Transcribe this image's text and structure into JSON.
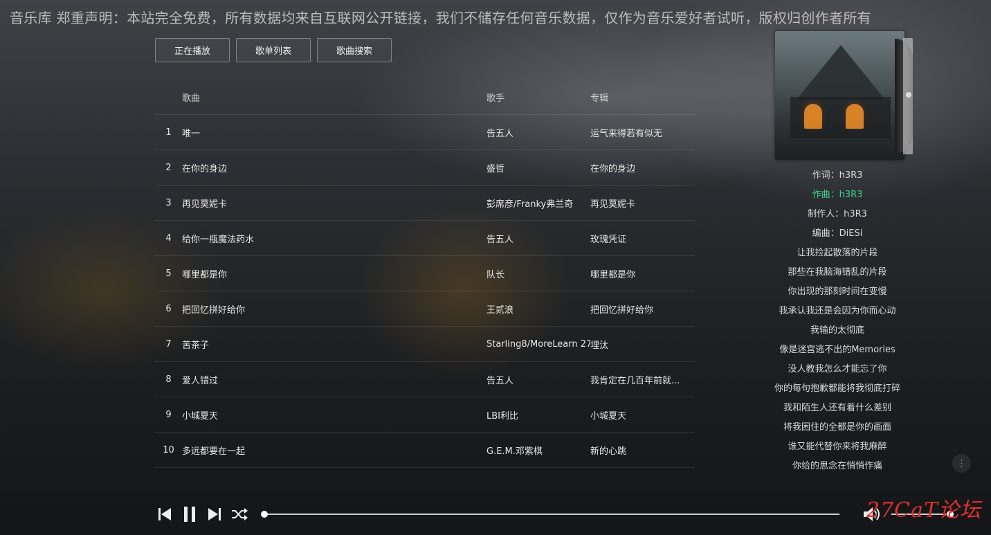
{
  "banner": "音乐库 郑重声明：本站完全免费，所有数据均来自互联网公开链接，我们不储存任何音乐数据，仅作为音乐爱好者试听，版权归创作者所有",
  "tabs": [
    {
      "label": "正在播放"
    },
    {
      "label": "歌单列表"
    },
    {
      "label": "歌曲搜索"
    }
  ],
  "table": {
    "headers": {
      "song": "歌曲",
      "artist": "歌手",
      "album": "专辑"
    },
    "rows": [
      {
        "num": "1",
        "song": "唯一",
        "artist": "告五人",
        "album": "运气来得若有似无"
      },
      {
        "num": "2",
        "song": "在你的身边",
        "artist": "盛哲",
        "album": "在你的身边"
      },
      {
        "num": "3",
        "song": "再见莫妮卡",
        "artist": "彭席彦/Franky弗兰奇",
        "album": "再见莫妮卡"
      },
      {
        "num": "4",
        "song": "给你一瓶魔法药水",
        "artist": "告五人",
        "album": "玫瑰凭证"
      },
      {
        "num": "5",
        "song": "哪里都是你",
        "artist": "队长",
        "album": "哪里都是你"
      },
      {
        "num": "6",
        "song": "把回忆拼好给你",
        "artist": "王贰浪",
        "album": "把回忆拼好给你"
      },
      {
        "num": "7",
        "song": "苦茶子",
        "artist": "Starling8/MoreLearn 27",
        "album": "埋汰"
      },
      {
        "num": "8",
        "song": "爱人错过",
        "artist": "告五人",
        "album": "我肯定在几百年前就..."
      },
      {
        "num": "9",
        "song": "小城夏天",
        "artist": "LBI利比",
        "album": "小城夏天"
      },
      {
        "num": "10",
        "song": "多远都要在一起",
        "artist": "G.E.M.邓紫棋",
        "album": "新的心跳"
      }
    ]
  },
  "lyrics": [
    {
      "text": "作词：h3R3",
      "active": false
    },
    {
      "text": "作曲：h3R3",
      "active": true
    },
    {
      "text": "制作人：h3R3",
      "active": false
    },
    {
      "text": "编曲：DiESi",
      "active": false
    },
    {
      "text": "让我捡起散落的片段",
      "active": false
    },
    {
      "text": "那些在我脑海错乱的片段",
      "active": false
    },
    {
      "text": "你出现的那刻时间在变慢",
      "active": false
    },
    {
      "text": "我承认我还是会因为你而心动",
      "active": false
    },
    {
      "text": "我输的太彻底",
      "active": false
    },
    {
      "text": "像是迷宫逃不出的Memories",
      "active": false
    },
    {
      "text": "没人教我怎么才能忘了你",
      "active": false
    },
    {
      "text": "你的每句抱歉都能将我彻底打碎",
      "active": false
    },
    {
      "text": "我和陌生人还有着什么差别",
      "active": false
    },
    {
      "text": "将我困住的全都是你的画面",
      "active": false
    },
    {
      "text": "谁又能代替你来将我麻醉",
      "active": false
    },
    {
      "text": "你给的思念在悄悄作痛",
      "active": false
    }
  ],
  "player": {
    "progress": 0.0,
    "volume": 1.0,
    "more_glyph": "⋮"
  },
  "watermark": "27CaT论坛",
  "colors": {
    "accent": "#3fd28c",
    "watermark": "#e0302a"
  },
  "icons": [
    "prev-icon",
    "pause-icon",
    "next-icon",
    "shuffle-icon",
    "volume-icon",
    "more-icon"
  ]
}
